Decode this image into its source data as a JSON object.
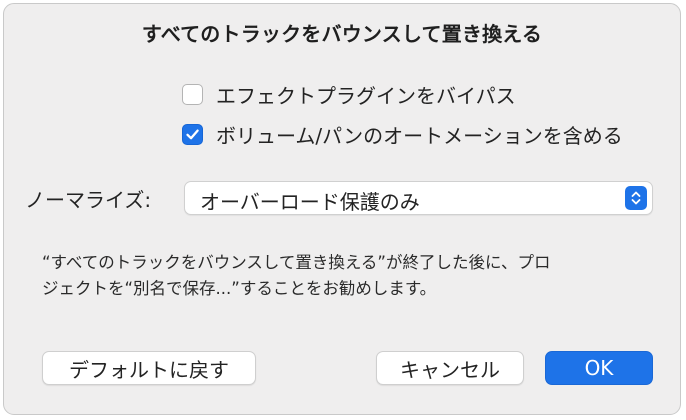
{
  "dialog": {
    "title": "すべてのトラックをバウンスして置き換える"
  },
  "options": [
    {
      "label": "エフェクトプラグインをバイパス",
      "checked": false
    },
    {
      "label": "ボリューム/パンのオートメーションを含める",
      "checked": true
    }
  ],
  "normalize": {
    "label": "ノーマライズ:",
    "selected": "オーバーロード保護のみ"
  },
  "note": {
    "line1": "“すべてのトラックをバウンスして置き換える”が終了した後に、プロ",
    "line2": "ジェクトを“別名で保存...”することをお勧めします。"
  },
  "buttons": {
    "defaults": "デフォルトに戻す",
    "cancel": "キャンセル",
    "ok": "OK"
  },
  "colors": {
    "accent": "#1e73e8",
    "dialog_bg": "#efeeee"
  }
}
